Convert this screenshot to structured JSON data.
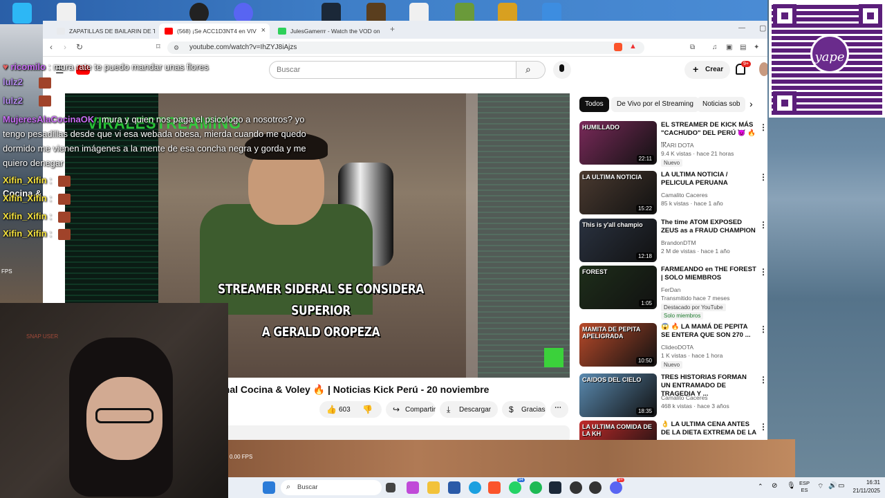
{
  "browser": {
    "tabs": [
      {
        "label": "ZAPATILLAS DE BAILARIN DE TUERA",
        "active": false
      },
      {
        "label": "(568) ¡Se ACC1D3NT4 en VIV",
        "active": true
      },
      {
        "label": "JulesGamerrr - Watch the VOD on Ki",
        "active": false
      }
    ],
    "url": "youtube.com/watch?v=IhZYJ8iAjzs"
  },
  "youtube": {
    "search_placeholder": "Buscar",
    "create_label": "Crear",
    "notif_count": "9+",
    "video_caption_line1": "STREAMER SIDERAL SE CONSIDERA SUPERIOR",
    "video_caption_line2": "A GERALD OROPEZA",
    "watermark": "VIRALESTREAMING",
    "video_title": "anal Cocina & Voley 🔥 | Noticias Kick Perú - 20 noviembre",
    "likes": "603",
    "share_label": "Compartir",
    "download_label": "Descargar",
    "thanks_label": "Gracias",
    "chips": [
      "Todos",
      "De Vivo por el Streaming",
      "Noticias sob"
    ],
    "recommendations": [
      {
        "title": "EL STREAMER DE KICK MÁS \"CACHUDO\" DEL PERÚ 😈 🔥 ...",
        "channel": "IKARI DOTA",
        "meta": "9.4 K vistas · hace 21 horas",
        "badge": "Nuevo",
        "duration": "22:11",
        "thumb_color": "#7a2a5a",
        "thumb_text": "HUMILLADO"
      },
      {
        "title": "LA ULTIMA NOTICIA / PELICULA PERUANA",
        "channel": "Camalito Caceres",
        "meta": "85 k vistas · hace 1 año",
        "badge": "",
        "duration": "15:22",
        "thumb_color": "#4a3a30",
        "thumb_text": "LA ULTIMA NOTICIA"
      },
      {
        "title": "The time ATOM EXPOSED ZEUS as a FRAUD CHAMPION",
        "channel": "BrandonDTM",
        "meta": "2 M de vistas · hace 1 año",
        "badge": "",
        "duration": "12:18",
        "thumb_color": "#2a3240",
        "thumb_text": "This is y'all champio"
      },
      {
        "title": "FARMEANDO en THE FOREST | SOLO MIEMBROS",
        "channel": "FerDan",
        "meta": "Transmitido hace 7 meses",
        "badge": "Destacado por YouTube",
        "badge2": "Solo miembros",
        "duration": "1:05",
        "thumb_color": "#1e2e1a",
        "thumb_text": "FOREST"
      },
      {
        "title": "😱 🔥 LA MAMÁ DE PEPITA SE ENTERA QUE SON 270 ...",
        "channel": "ClideoDOTA",
        "meta": "1 K vistas · hace 1 hora",
        "badge": "Nuevo",
        "duration": "10:50",
        "thumb_color": "#b84a2a",
        "thumb_text": "MAMITA DE PEPITA APELIGRADA"
      },
      {
        "title": "TRES HISTORIAS FORMAN UN ENTRAMADO DE TRAGEDIA Y ...",
        "channel": "Camalito Caceres",
        "meta": "468 k vistas · hace 3 años",
        "badge": "",
        "duration": "18:35",
        "thumb_color": "#5a8ab0",
        "thumb_text": "CAIDOS DEL CIELO"
      },
      {
        "title": "👌 LA ULTIMA CENA ANTES DE LA DIETA EXTREMA DE LA ...",
        "channel": "",
        "meta": "",
        "badge": "",
        "duration": "",
        "thumb_color": "#c02a2a",
        "thumb_text": "LA ULTIMA COMIDA DE LA KH"
      }
    ]
  },
  "chat": {
    "lines": [
      {
        "user": "ricomilo",
        "user_color": "p",
        "text": ": mura rate te puedo mandar unas flores"
      },
      {
        "user": "MujeresAlaCocinaOK",
        "user_color": "p",
        "text": ": mura y quien nos paga el psicologo a nosotros? yo"
      },
      {
        "user": "",
        "user_color": "",
        "text": "tengo pesadillas desde que vi esa webada obesa, mierda cuando me quedo"
      },
      {
        "user": "",
        "user_color": "",
        "text": "dormido me vienen imágenes a la mente de esa concha negra y gorda y me"
      },
      {
        "user": "",
        "user_color": "",
        "text": "quiero denegar"
      },
      {
        "user": "Xifin_Xifin",
        "user_color": "y",
        "text": ":"
      },
      {
        "user": "Xifin_Xifin",
        "user_color": "y",
        "text": ":"
      },
      {
        "user": "Xifin_Xifin",
        "user_color": "y",
        "text": ":"
      },
      {
        "user": "Xifin_Xifin",
        "user_color": "y",
        "text": ":"
      }
    ],
    "side_labels": [
      "lulz2",
      "lulz2",
      "Cocina &"
    ]
  },
  "overlay": {
    "fps_left": "FPS",
    "fps_bottom": "0.00 FPS",
    "snap_label": "SNAP USER",
    "yape": "yape"
  },
  "taskbar": {
    "search_placeholder": "Buscar",
    "lang_top": "ESP",
    "lang_bottom": "ES",
    "time": "16:31",
    "date": "21/11/2025",
    "badges": {
      "whatsapp": "94",
      "discord": "9+"
    }
  },
  "colors": {
    "yt_red": "#ff0000",
    "yape_purple": "#5b1e7a",
    "taskbar_bg": "#e9eef5"
  }
}
